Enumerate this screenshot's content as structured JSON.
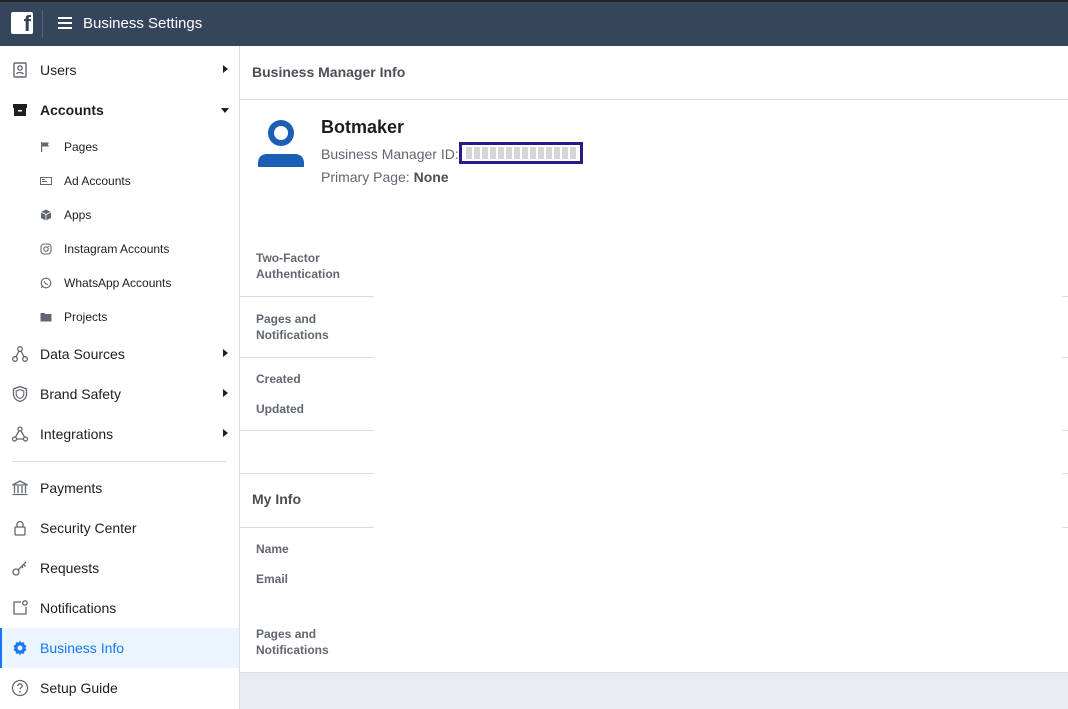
{
  "topbar": {
    "title": "Business Settings"
  },
  "sidebar": {
    "users": "Users",
    "accounts": "Accounts",
    "sub": {
      "pages": "Pages",
      "ad_accounts": "Ad Accounts",
      "apps": "Apps",
      "instagram": "Instagram Accounts",
      "whatsapp": "WhatsApp Accounts",
      "projects": "Projects"
    },
    "data_sources": "Data Sources",
    "brand_safety": "Brand Safety",
    "integrations": "Integrations",
    "payments": "Payments",
    "security_center": "Security Center",
    "requests": "Requests",
    "notifications": "Notifications",
    "business_info": "Business Info",
    "setup_guide": "Setup Guide",
    "active_color": "#1877f2"
  },
  "main": {
    "header": "Business Manager Info",
    "business_name": "Botmaker",
    "business_id_label": "Business Manager ID:",
    "primary_page_label": "Primary Page:",
    "primary_page_value": "None",
    "two_factor": "Two-Factor Authentication",
    "pages_notifications": "Pages and Notifications",
    "created": "Created",
    "updated": "Updated",
    "my_info": "My Info",
    "name": "Name",
    "email": "Email",
    "pages_notifications_2": "Pages and Notifications"
  }
}
